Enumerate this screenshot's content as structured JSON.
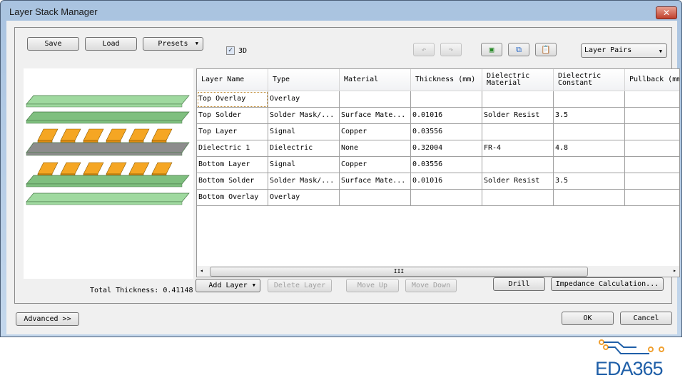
{
  "window": {
    "title": "Layer Stack Manager",
    "close_label": "✕"
  },
  "toolbar": {
    "save": "Save",
    "load": "Load",
    "presets": "Presets",
    "three_d_label": "3D",
    "three_d_checked": true,
    "view_select": "Layer Pairs"
  },
  "table": {
    "headers": [
      "Layer Name",
      "Type",
      "Material",
      "Thickness (mm)",
      "Dielectric\nMaterial",
      "Dielectric\nConstant",
      "Pullback (mm"
    ],
    "rows": [
      [
        "Top Overlay",
        "Overlay",
        "",
        "",
        "",
        "",
        ""
      ],
      [
        "Top Solder",
        "Solder Mask/...",
        "Surface Mate...",
        "0.01016",
        "Solder Resist",
        "3.5",
        ""
      ],
      [
        "Top Layer",
        "Signal",
        "Copper",
        "0.03556",
        "",
        "",
        ""
      ],
      [
        "Dielectric 1",
        "Dielectric",
        "None",
        "0.32004",
        "FR-4",
        "4.8",
        ""
      ],
      [
        "Bottom Layer",
        "Signal",
        "Copper",
        "0.03556",
        "",
        "",
        ""
      ],
      [
        "Bottom Solder",
        "Solder Mask/...",
        "Surface Mate...",
        "0.01016",
        "Solder Resist",
        "3.5",
        ""
      ],
      [
        "Bottom Overlay",
        "Overlay",
        "",
        "",
        "",
        "",
        ""
      ]
    ]
  },
  "footer": {
    "total_thickness": "Total Thickness: 0.41148",
    "add_layer": "Add Layer",
    "delete_layer": "Delete Layer",
    "move_up": "Move Up",
    "move_down": "Move Down",
    "drill": "Drill",
    "impedance": "Impedance Calculation...",
    "advanced": "Advanced >>",
    "ok": "OK",
    "cancel": "Cancel"
  },
  "watermark": {
    "text": "EDA365"
  },
  "colors": {
    "overlay": "#9fd99f",
    "solder": "#7fbf7f",
    "copper": "#f5a623",
    "dielectric": "#8c8c8c",
    "brand": "#1f5fa8"
  }
}
